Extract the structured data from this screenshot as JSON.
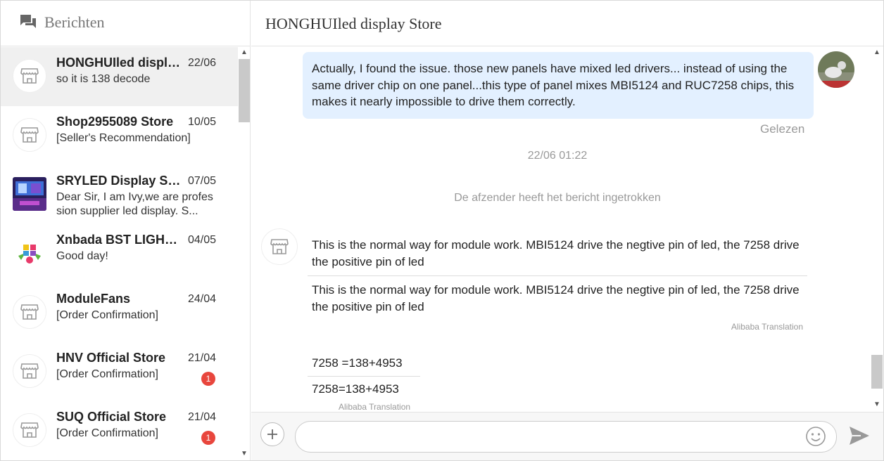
{
  "sidebar": {
    "title": "Berichten",
    "conversations": [
      {
        "name": "HONGHUIled display Store",
        "date": "22/06",
        "preview": "so it is 138 decode",
        "active": true,
        "avatar": "store-icon"
      },
      {
        "name": "Shop2955089 Store",
        "date": "10/05",
        "preview": "[Seller's Recommendation]",
        "avatar": "store-icon"
      },
      {
        "name": "SRYLED Display Store",
        "date": "07/05",
        "preview": "Dear Sir, I am Ivy,we are profes sion supplier led display. S...",
        "avatar": "led-display-photo"
      },
      {
        "name": "Xnbada BST LIGHTING Store",
        "date": "04/05",
        "preview": "Good day!",
        "avatar": "sale-logo"
      },
      {
        "name": "ModuleFans",
        "date": "24/04",
        "preview": "[Order Confirmation]",
        "avatar": "store-icon"
      },
      {
        "name": "HNV Official Store",
        "date": "21/04",
        "preview": "[Order Confirmation]",
        "badge": "1",
        "avatar": "store-icon"
      },
      {
        "name": "SUQ Official Store",
        "date": "21/04",
        "preview": "[Order Confirmation]",
        "badge": "1",
        "avatar": "store-icon"
      }
    ]
  },
  "chat": {
    "title": "HONGHUIled display Store",
    "messages": {
      "my_message": "Actually, I found the issue.  those new panels have mixed led drivers... instead of using the same driver chip on one panel...this type of panel mixes MBI5124 and RUC7258 chips, this makes it nearly impossible to drive them correctly.",
      "read_status": "Gelezen",
      "timestamp": "22/06 01:22",
      "recalled_notice": "De afzender heeft het bericht ingetrokken",
      "seller_message_1": {
        "original": "This is the normal way for module work. MBI5124 drive the negtive pin of led, the 7258 drive the positive pin of led",
        "translation": "This is the normal way for module work. MBI5124 drive the negtive pin of led, the 7258 drive the positive pin of led",
        "translation_tag": "Alibaba Translation"
      },
      "seller_message_2": {
        "original": "7258  =138+4953",
        "translation": "7258=138+4953",
        "translation_tag": "Alibaba Translation"
      }
    },
    "input": {
      "value": "",
      "placeholder": ""
    }
  },
  "colors": {
    "my_bubble": "#e3f0ff",
    "badge": "#e8463d",
    "active_row": "#f0f0f0"
  }
}
